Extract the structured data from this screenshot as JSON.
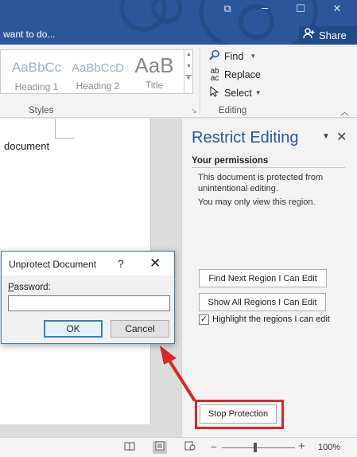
{
  "colors": {
    "word_blue": "#2b579a",
    "highlight_red": "#d9272c",
    "pane_title_blue": "#2b579a"
  },
  "titlebar": {
    "tell_me": "want to do...",
    "share": "Share",
    "icons": {
      "ribbon_options": "ribbon-display-options-icon",
      "minimize": "minimize-icon",
      "maximize": "maximize-icon",
      "close": "close-icon",
      "share": "person-add-icon"
    }
  },
  "ribbon": {
    "styles": [
      {
        "preview": "AaBbCc",
        "name": "Heading 1"
      },
      {
        "preview": "AaBbCcD",
        "name": "Heading 2"
      },
      {
        "preview": "AaB",
        "name": "Title"
      }
    ],
    "styles_group_label": "Styles",
    "editing": {
      "find": "Find",
      "replace": "Replace",
      "select": "Select"
    },
    "editing_group_label": "Editing"
  },
  "document": {
    "text": "document"
  },
  "restrict_pane": {
    "title": "Restrict Editing",
    "permissions_header": "Your permissions",
    "protected_text": "This document is protected from unintentional editing.",
    "view_text": "You may only view this region.",
    "find_next_region": "Find Next Region I Can Edit",
    "show_all_regions": "Show All Regions I Can Edit",
    "highlight_label": "Highlight the regions I can edit",
    "highlight_checked": true,
    "stop_protection": "Stop Protection"
  },
  "dialog": {
    "title": "Unprotect Document",
    "help": "?",
    "password_label": "Password:",
    "password_value": "",
    "ok": "OK",
    "cancel": "Cancel"
  },
  "statusbar": {
    "zoom_level": "100%",
    "zoom_fraction": 0.46
  }
}
